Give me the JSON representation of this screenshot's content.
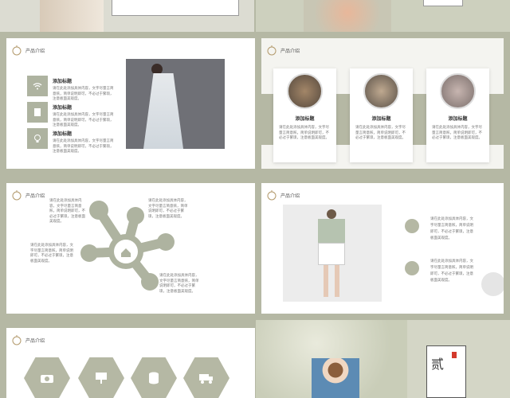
{
  "colors": {
    "bg": "#b5b8a4",
    "accent": "#aeb3a0",
    "red": "#d33a2c"
  },
  "header_label": "产品介绍",
  "slide_b": {
    "items": [
      {
        "title": "添加标题",
        "text": "请在此处添加具体内容，文字尽量言简意赅，简单说明即可，不必过于繁琐，注意板面美观度。",
        "icon": "wifi-icon"
      },
      {
        "title": "添加标题",
        "text": "请在此处添加具体内容，文字尽量言简意赅，简单说明即可，不必过于繁琐，注意板面美观度。",
        "icon": "document-icon"
      },
      {
        "title": "添加标题",
        "text": "请在此处添加具体内容，文字尽量言简意赅，简单说明即可，不必过于繁琐，注意板面美观度。",
        "icon": "lightbulb-icon"
      }
    ]
  },
  "slide_c": {
    "cards": [
      {
        "title": "添加标题",
        "text": "请在此处添加具体内容，文字尽量言简意赅，简单说明即可，不必过于繁琐，注意板面美观度。"
      },
      {
        "title": "添加标题",
        "text": "请在此处添加具体内容，文字尽量言简意赅，简单说明即可，不必过于繁琐，注意板面美观度。"
      },
      {
        "title": "添加标题",
        "text": "请在此处添加具体内容，文字尽量言简意赅，简单说明即可，不必过于繁琐，注意板面美观度。"
      }
    ]
  },
  "slide_d": {
    "texts": [
      "请在此处添加具体内容，文字尽量言简意赅，简单说明即可，不必过于繁琐，注意板面美观度。",
      "请在此处添加具体内容，文字尽量言简意赅，简单说明即可，不必过于繁琐，注意板面美观度。",
      "请在此处添加具体内容，文字尽量言简意赅，简单说明即可，不必过于繁琐，注意板面美观度。",
      "请在此处添加具体内容，文字尽量言简意赅，简单说明即可，不必过于繁琐，注意板面美观度。"
    ]
  },
  "slide_e": {
    "texts": [
      "请在此处添加具体内容，文字尽量言简意赅，简单说明即可，不必过于繁琐，注意板面美观度。",
      "请在此处添加具体内容，文字尽量言简意赅，简单说明即可，不必过于繁琐，注意板面美观度。"
    ]
  },
  "slide_g": {
    "title": "贰"
  }
}
